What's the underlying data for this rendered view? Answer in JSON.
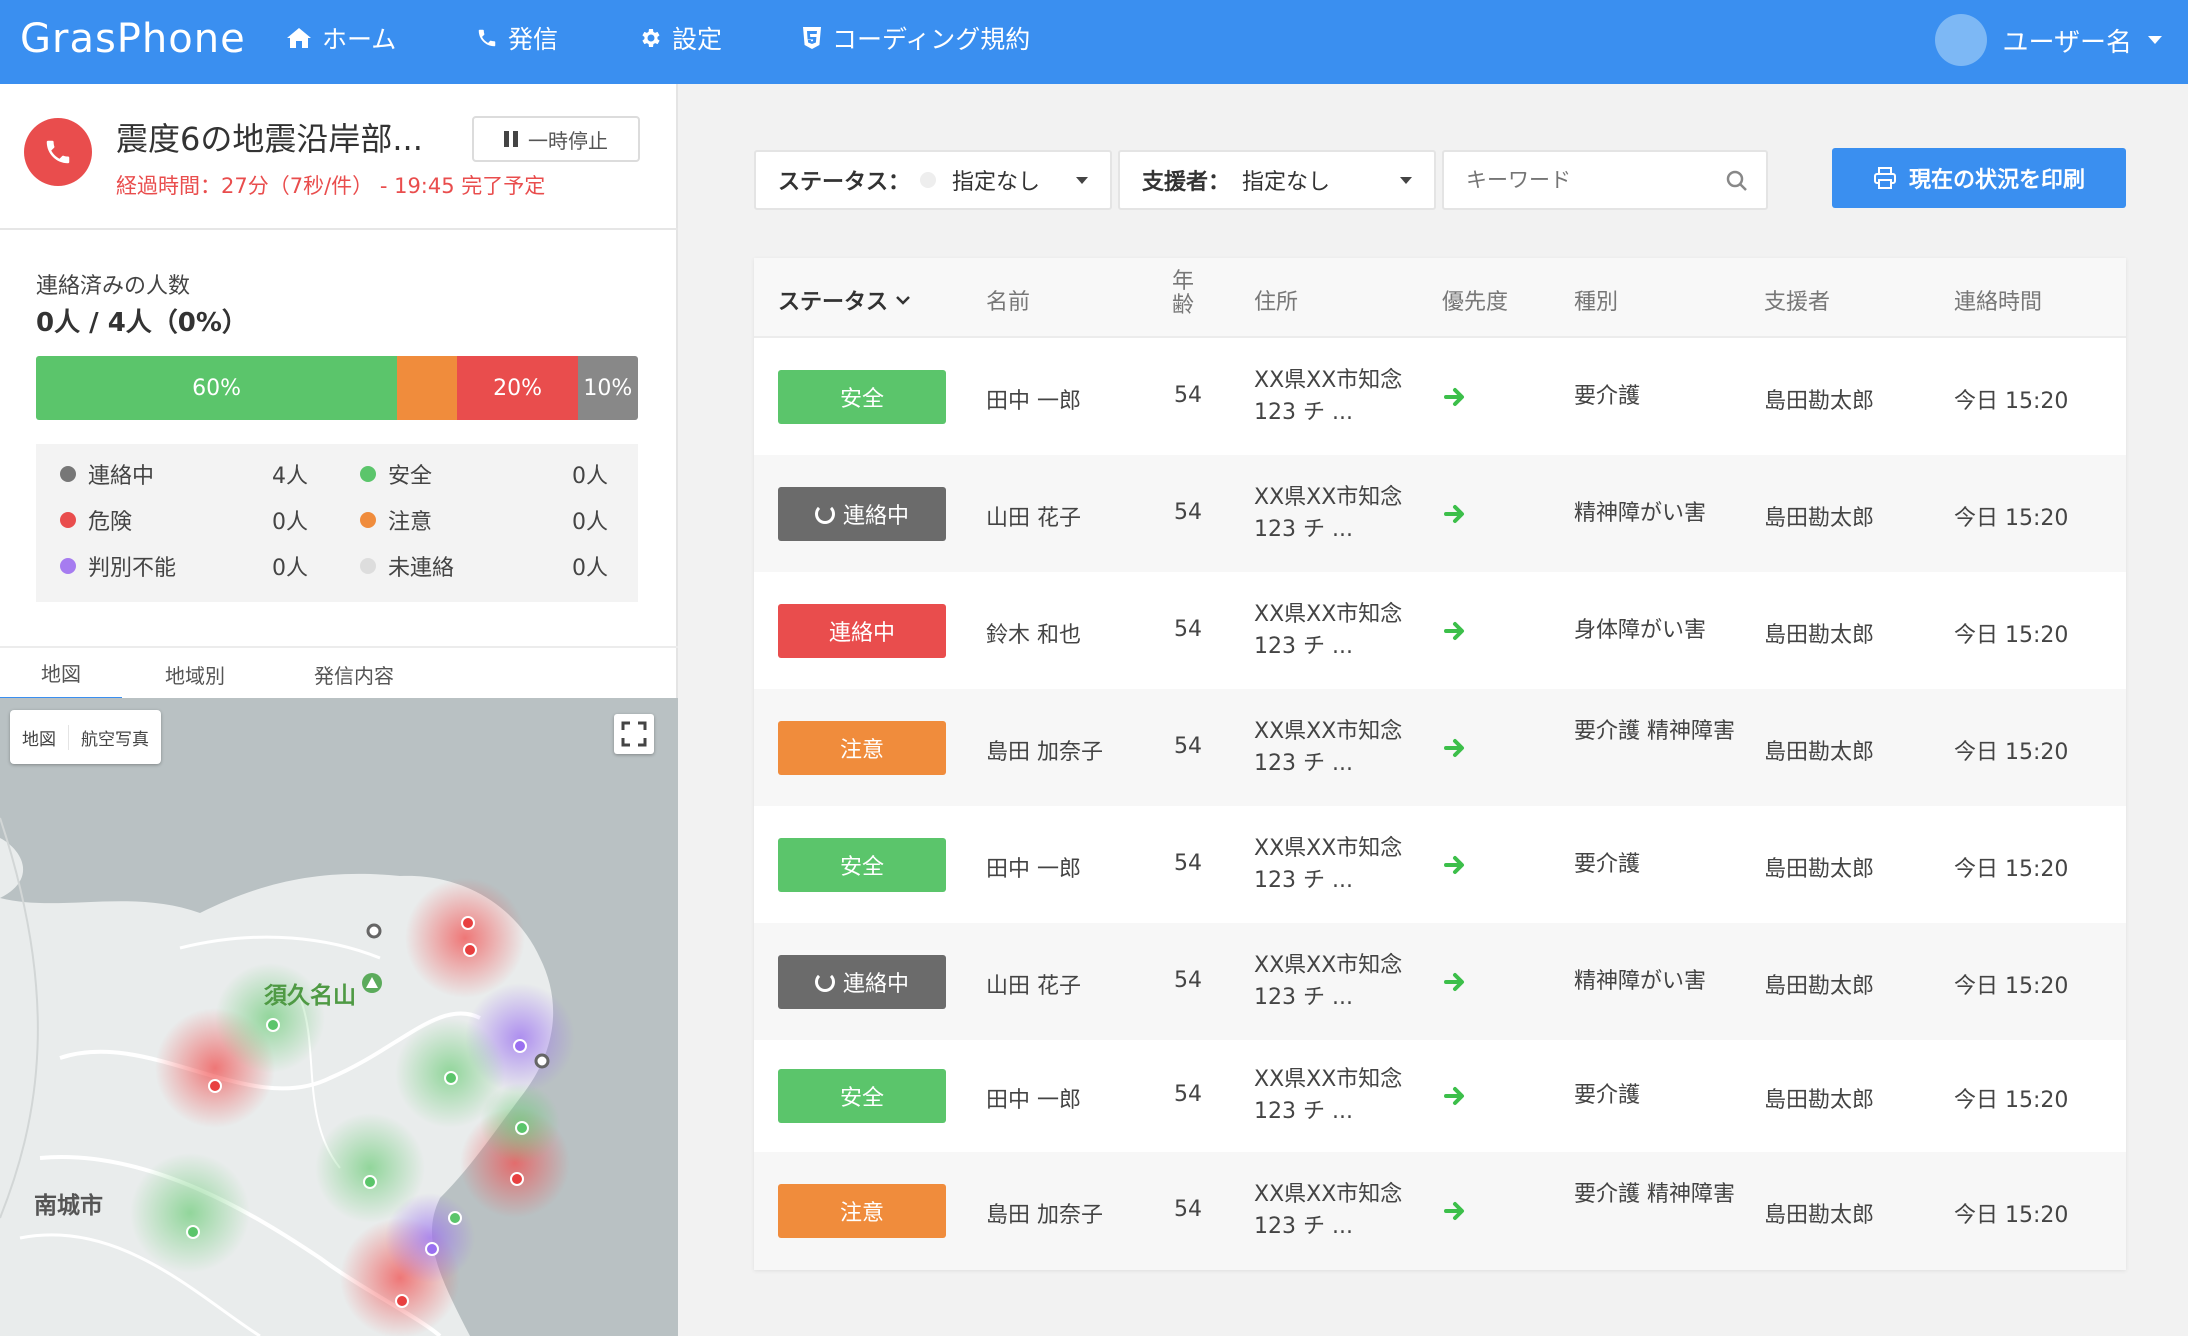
{
  "app": {
    "brand": "GrasPhone"
  },
  "nav": [
    {
      "label": "ホーム",
      "icon": "home-icon"
    },
    {
      "label": "発信",
      "icon": "phone-icon"
    },
    {
      "label": "設定",
      "icon": "gear-icon"
    },
    {
      "label": "コーディング規約",
      "icon": "html5-icon"
    }
  ],
  "user": {
    "name": "ユーザー名"
  },
  "call": {
    "title": "震度6の地震沿岸部...",
    "elapsed": "経過時間：27分（7秒/件） - 19:45 完了予定",
    "pause_label": "一時停止"
  },
  "contacts": {
    "label": "連絡済みの人数",
    "count": "0人 / 4人（0%）",
    "progress": [
      {
        "label": "60%",
        "value": 60,
        "color": "#5bc56b"
      },
      {
        "label": "",
        "value": 10,
        "color": "#f08c3c"
      },
      {
        "label": "20%",
        "value": 20,
        "color": "#e94d4d"
      },
      {
        "label": "10%",
        "value": 10,
        "color": "#888888"
      }
    ],
    "legend": [
      {
        "label": "連絡中",
        "value": "4人",
        "color": "#777777"
      },
      {
        "label": "安全",
        "value": "0人",
        "color": "#5bc56b"
      },
      {
        "label": "危険",
        "value": "0人",
        "color": "#e94d4d"
      },
      {
        "label": "注意",
        "value": "0人",
        "color": "#f08c3c"
      },
      {
        "label": "判別不能",
        "value": "0人",
        "color": "#a67cf0"
      },
      {
        "label": "未連絡",
        "value": "0人",
        "color": "#dddddd"
      }
    ]
  },
  "tabs": [
    "地図",
    "地域別",
    "発信内容"
  ],
  "map": {
    "types": [
      "地図",
      "航空写真"
    ],
    "labels": {
      "mountain": "須久名山",
      "city": "南城市"
    }
  },
  "filters": {
    "status_label": "ステータス：",
    "status_value": "指定なし",
    "supporter_label": "支援者：",
    "supporter_value": "指定なし",
    "keyword_placeholder": "キーワード"
  },
  "print_label": "現在の状況を印刷",
  "table": {
    "headers": {
      "status": "ステータス",
      "name": "名前",
      "age": "年齢",
      "address": "住所",
      "priority": "優先度",
      "type": "種別",
      "supporter": "支援者",
      "time": "連絡時間"
    },
    "rows": [
      {
        "status": "安全",
        "status_color": "#5bc56b",
        "spinner": false,
        "name": "田中 一郎",
        "age": "54",
        "address": "XX県XX市知念123 チ ...",
        "type": "要介護",
        "supporter": "島田勘太郎",
        "time": "今日 15:20"
      },
      {
        "status": "連絡中",
        "status_color": "#6b6b6b",
        "spinner": true,
        "name": "山田 花子",
        "age": "54",
        "address": "XX県XX市知念123 チ ...",
        "type": "精神障がい害",
        "supporter": "島田勘太郎",
        "time": "今日 15:20"
      },
      {
        "status": "連絡中",
        "status_color": "#e94d4d",
        "spinner": false,
        "name": "鈴木 和也",
        "age": "54",
        "address": "XX県XX市知念123 チ ...",
        "type": "身体障がい害",
        "supporter": "島田勘太郎",
        "time": "今日 15:20"
      },
      {
        "status": "注意",
        "status_color": "#f08c3c",
        "spinner": false,
        "name": "島田 加奈子",
        "age": "54",
        "address": "XX県XX市知念123 チ ...",
        "type": "要介護 精神障害",
        "supporter": "島田勘太郎",
        "time": "今日 15:20"
      },
      {
        "status": "安全",
        "status_color": "#5bc56b",
        "spinner": false,
        "name": "田中 一郎",
        "age": "54",
        "address": "XX県XX市知念123 チ ...",
        "type": "要介護",
        "supporter": "島田勘太郎",
        "time": "今日 15:20"
      },
      {
        "status": "連絡中",
        "status_color": "#6b6b6b",
        "spinner": true,
        "name": "山田 花子",
        "age": "54",
        "address": "XX県XX市知念123 チ ...",
        "type": "精神障がい害",
        "supporter": "島田勘太郎",
        "time": "今日 15:20"
      },
      {
        "status": "安全",
        "status_color": "#5bc56b",
        "spinner": false,
        "name": "田中 一郎",
        "age": "54",
        "address": "XX県XX市知念123 チ ...",
        "type": "要介護",
        "supporter": "島田勘太郎",
        "time": "今日 15:20"
      },
      {
        "status": "注意",
        "status_color": "#f08c3c",
        "spinner": false,
        "name": "島田 加奈子",
        "age": "54",
        "address": "XX県XX市知念123 チ ...",
        "type": "要介護 精神障害",
        "supporter": "島田勘太郎",
        "time": "今日 15:20"
      }
    ]
  }
}
